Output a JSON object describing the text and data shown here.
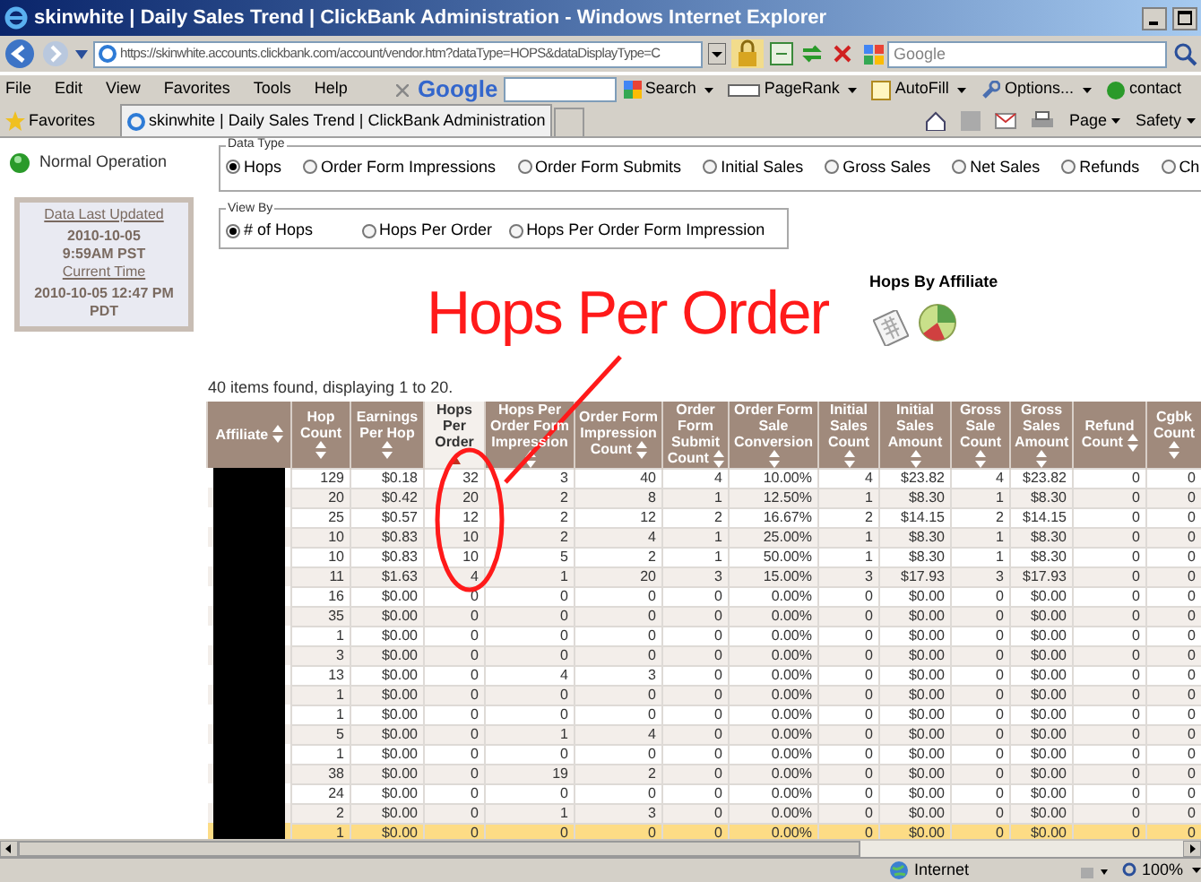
{
  "browser": {
    "title": "skinwhite | Daily Sales Trend | ClickBank Administration - Windows Internet Explorer",
    "address": "https://skinwhite.accounts.clickbank.com/account/vendor.htm?dataType=HOPS&dataDisplayType=C",
    "search_placeholder": "Google",
    "menu": [
      "File",
      "Edit",
      "View",
      "Favorites",
      "Tools",
      "Help"
    ],
    "google_logo": "Google",
    "toolbar": [
      {
        "kind": "search",
        "label": "Search"
      },
      {
        "kind": "pagerank",
        "label": "PageRank"
      },
      {
        "kind": "autofill",
        "label": "AutoFill"
      },
      {
        "kind": "options",
        "label": "Options..."
      },
      {
        "kind": "contact",
        "label": "contact"
      }
    ],
    "favorites": "Favorites",
    "tabs": [
      {
        "label": "skinwhite | Daily Sales Trend | ClickBank Administration",
        "selected": true
      }
    ],
    "commands": [
      "Page",
      "Safety"
    ],
    "status_bar": {
      "zone": "Internet",
      "zoom": "100%"
    }
  },
  "page": {
    "status": "Normal Operation",
    "update_box": {
      "updated_label": "Data Last Updated",
      "updated": "2010-10-05 9:59AM PST",
      "current_label": "Current Time",
      "current": "2010-10-05 12:47 PM PDT"
    },
    "data_type": {
      "legend": "Data Type",
      "options": [
        {
          "label": "Hops",
          "selected": true
        },
        {
          "label": "Order Form Impressions",
          "selected": false
        },
        {
          "label": "Order Form Submits",
          "selected": false
        },
        {
          "label": "Initial Sales",
          "selected": false
        },
        {
          "label": "Gross Sales",
          "selected": false
        },
        {
          "label": "Net Sales",
          "selected": false
        },
        {
          "label": "Refunds",
          "selected": false
        },
        {
          "label": "Ch",
          "selected": false
        }
      ]
    },
    "view_by": {
      "legend": "View By",
      "options": [
        {
          "label": "# of Hops",
          "selected": true
        },
        {
          "label": "Hops Per Order",
          "selected": false
        },
        {
          "label": "Hops Per Order Form Impression",
          "selected": false
        }
      ]
    },
    "annotation": {
      "text": "Hops Per Order"
    },
    "chart_link": {
      "title": "Hops By Affiliate"
    },
    "result_count": "40 items found, displaying 1 to 20.",
    "table": {
      "columns": [
        {
          "label": "Affiliate",
          "sorted": false
        },
        {
          "label": "Hop Count",
          "sorted": false
        },
        {
          "label": "Earnings Per Hop",
          "sorted": false
        },
        {
          "label": "Hops Per Order",
          "sorted": true
        },
        {
          "label": "Hops Per Order Form Impression",
          "sorted": false
        },
        {
          "label": "Order Form Impression Count",
          "sorted": false
        },
        {
          "label": "Order Form Submit Count",
          "sorted": false
        },
        {
          "label": "Order Form Sale Conversion",
          "sorted": false
        },
        {
          "label": "Initial Sales Count",
          "sorted": false
        },
        {
          "label": "Initial Sales Amount",
          "sorted": false
        },
        {
          "label": "Gross Sale Count",
          "sorted": false
        },
        {
          "label": "Gross Sales Amount",
          "sorted": false
        },
        {
          "label": "Refund Count",
          "sorted": false
        },
        {
          "label": "Cgbk Count",
          "sorted": false
        }
      ],
      "rows": [
        {
          "highlighted": false,
          "cells": [
            "",
            "129",
            "$0.18",
            "32",
            "3",
            "40",
            "4",
            "10.00%",
            "4",
            "$23.82",
            "4",
            "$23.82",
            "0",
            "0"
          ]
        },
        {
          "highlighted": false,
          "cells": [
            "",
            "20",
            "$0.42",
            "20",
            "2",
            "8",
            "1",
            "12.50%",
            "1",
            "$8.30",
            "1",
            "$8.30",
            "0",
            "0"
          ]
        },
        {
          "highlighted": false,
          "cells": [
            "",
            "25",
            "$0.57",
            "12",
            "2",
            "12",
            "2",
            "16.67%",
            "2",
            "$14.15",
            "2",
            "$14.15",
            "0",
            "0"
          ]
        },
        {
          "highlighted": false,
          "cells": [
            "",
            "10",
            "$0.83",
            "10",
            "2",
            "4",
            "1",
            "25.00%",
            "1",
            "$8.30",
            "1",
            "$8.30",
            "0",
            "0"
          ]
        },
        {
          "highlighted": false,
          "cells": [
            "",
            "10",
            "$0.83",
            "10",
            "5",
            "2",
            "1",
            "50.00%",
            "1",
            "$8.30",
            "1",
            "$8.30",
            "0",
            "0"
          ]
        },
        {
          "highlighted": false,
          "cells": [
            "",
            "11",
            "$1.63",
            "4",
            "1",
            "20",
            "3",
            "15.00%",
            "3",
            "$17.93",
            "3",
            "$17.93",
            "0",
            "0"
          ]
        },
        {
          "highlighted": false,
          "cells": [
            "",
            "16",
            "$0.00",
            "0",
            "0",
            "0",
            "0",
            "0.00%",
            "0",
            "$0.00",
            "0",
            "$0.00",
            "0",
            "0"
          ]
        },
        {
          "highlighted": false,
          "cells": [
            "",
            "35",
            "$0.00",
            "0",
            "0",
            "0",
            "0",
            "0.00%",
            "0",
            "$0.00",
            "0",
            "$0.00",
            "0",
            "0"
          ]
        },
        {
          "highlighted": false,
          "cells": [
            "",
            "1",
            "$0.00",
            "0",
            "0",
            "0",
            "0",
            "0.00%",
            "0",
            "$0.00",
            "0",
            "$0.00",
            "0",
            "0"
          ]
        },
        {
          "highlighted": false,
          "cells": [
            "",
            "3",
            "$0.00",
            "0",
            "0",
            "0",
            "0",
            "0.00%",
            "0",
            "$0.00",
            "0",
            "$0.00",
            "0",
            "0"
          ]
        },
        {
          "highlighted": false,
          "cells": [
            "",
            "13",
            "$0.00",
            "0",
            "4",
            "3",
            "0",
            "0.00%",
            "0",
            "$0.00",
            "0",
            "$0.00",
            "0",
            "0"
          ]
        },
        {
          "highlighted": false,
          "cells": [
            "",
            "1",
            "$0.00",
            "0",
            "0",
            "0",
            "0",
            "0.00%",
            "0",
            "$0.00",
            "0",
            "$0.00",
            "0",
            "0"
          ]
        },
        {
          "highlighted": false,
          "cells": [
            "",
            "1",
            "$0.00",
            "0",
            "0",
            "0",
            "0",
            "0.00%",
            "0",
            "$0.00",
            "0",
            "$0.00",
            "0",
            "0"
          ]
        },
        {
          "highlighted": false,
          "cells": [
            "",
            "5",
            "$0.00",
            "0",
            "1",
            "4",
            "0",
            "0.00%",
            "0",
            "$0.00",
            "0",
            "$0.00",
            "0",
            "0"
          ]
        },
        {
          "highlighted": false,
          "cells": [
            "",
            "1",
            "$0.00",
            "0",
            "0",
            "0",
            "0",
            "0.00%",
            "0",
            "$0.00",
            "0",
            "$0.00",
            "0",
            "0"
          ]
        },
        {
          "highlighted": false,
          "cells": [
            "",
            "38",
            "$0.00",
            "0",
            "19",
            "2",
            "0",
            "0.00%",
            "0",
            "$0.00",
            "0",
            "$0.00",
            "0",
            "0"
          ]
        },
        {
          "highlighted": false,
          "cells": [
            "",
            "24",
            "$0.00",
            "0",
            "0",
            "0",
            "0",
            "0.00%",
            "0",
            "$0.00",
            "0",
            "$0.00",
            "0",
            "0"
          ]
        },
        {
          "highlighted": false,
          "cells": [
            "",
            "2",
            "$0.00",
            "0",
            "1",
            "3",
            "0",
            "0.00%",
            "0",
            "$0.00",
            "0",
            "$0.00",
            "0",
            "0"
          ]
        },
        {
          "highlighted": true,
          "cells": [
            "",
            "1",
            "$0.00",
            "0",
            "0",
            "0",
            "0",
            "0.00%",
            "0",
            "$0.00",
            "0",
            "$0.00",
            "0",
            "0"
          ]
        }
      ]
    }
  }
}
